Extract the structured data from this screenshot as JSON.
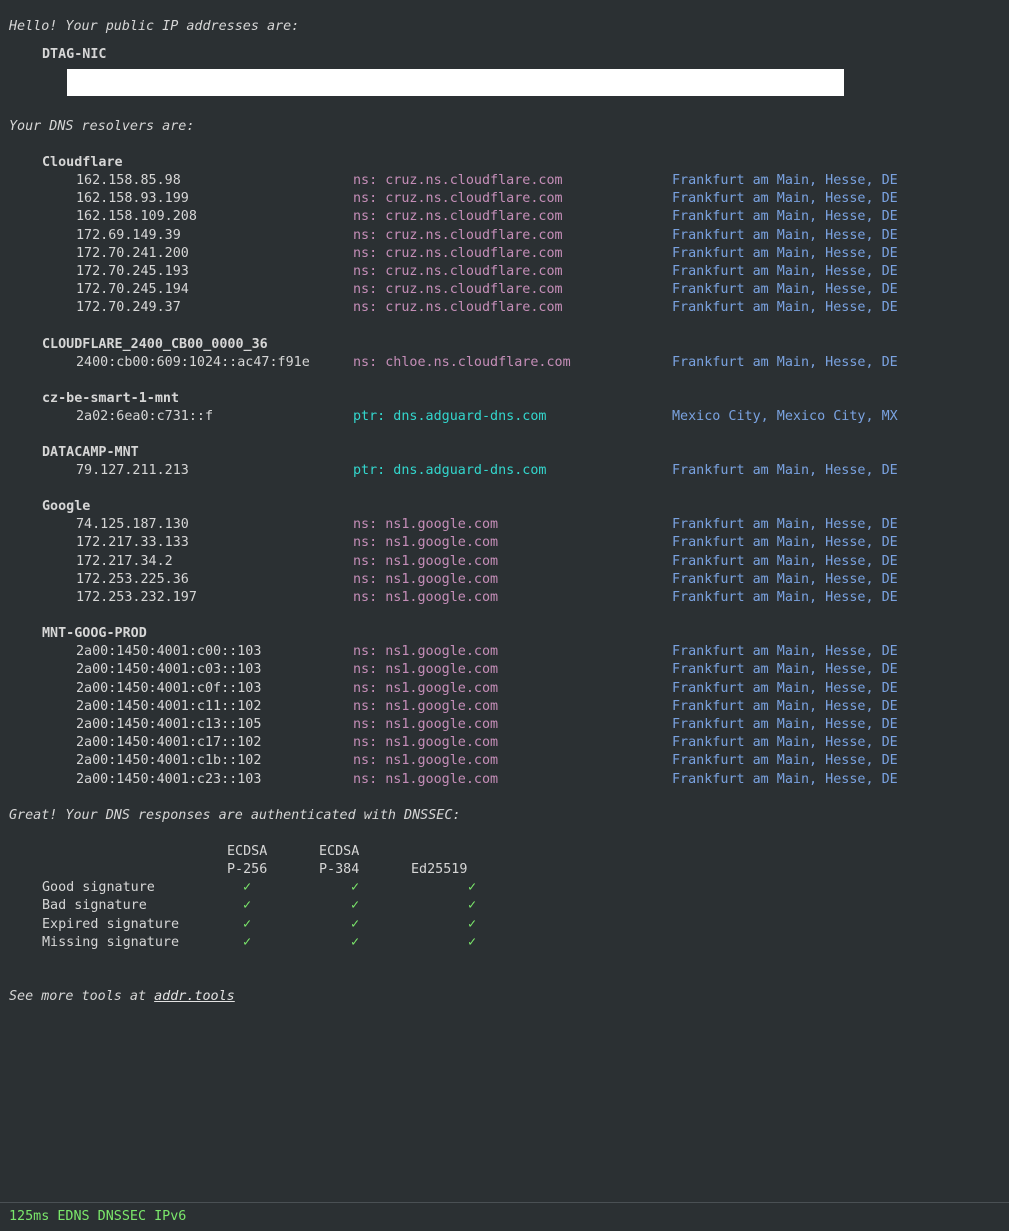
{
  "intro": "Hello! Your public IP addresses are:",
  "public_ip": {
    "org": "DTAG-NIC"
  },
  "resolvers_title": "Your DNS resolvers are:",
  "resolvers": [
    {
      "name": "Cloudflare",
      "rows": [
        {
          "ip": "162.158.85.98",
          "kind": "ns",
          "host": "ns: cruz.ns.cloudflare.com",
          "loc": "Frankfurt am Main, Hesse, DE"
        },
        {
          "ip": "162.158.93.199",
          "kind": "ns",
          "host": "ns: cruz.ns.cloudflare.com",
          "loc": "Frankfurt am Main, Hesse, DE"
        },
        {
          "ip": "162.158.109.208",
          "kind": "ns",
          "host": "ns: cruz.ns.cloudflare.com",
          "loc": "Frankfurt am Main, Hesse, DE"
        },
        {
          "ip": "172.69.149.39",
          "kind": "ns",
          "host": "ns: cruz.ns.cloudflare.com",
          "loc": "Frankfurt am Main, Hesse, DE"
        },
        {
          "ip": "172.70.241.200",
          "kind": "ns",
          "host": "ns: cruz.ns.cloudflare.com",
          "loc": "Frankfurt am Main, Hesse, DE"
        },
        {
          "ip": "172.70.245.193",
          "kind": "ns",
          "host": "ns: cruz.ns.cloudflare.com",
          "loc": "Frankfurt am Main, Hesse, DE"
        },
        {
          "ip": "172.70.245.194",
          "kind": "ns",
          "host": "ns: cruz.ns.cloudflare.com",
          "loc": "Frankfurt am Main, Hesse, DE"
        },
        {
          "ip": "172.70.249.37",
          "kind": "ns",
          "host": "ns: cruz.ns.cloudflare.com",
          "loc": "Frankfurt am Main, Hesse, DE"
        }
      ]
    },
    {
      "name": "CLOUDFLARE_2400_CB00_0000_36",
      "rows": [
        {
          "ip": "2400:cb00:609:1024::ac47:f91e",
          "kind": "ns",
          "host": "ns: chloe.ns.cloudflare.com",
          "loc": "Frankfurt am Main, Hesse, DE"
        }
      ]
    },
    {
      "name": "cz-be-smart-1-mnt",
      "rows": [
        {
          "ip": "2a02:6ea0:c731::f",
          "kind": "ptr",
          "host": "ptr: dns.adguard-dns.com",
          "loc": "Mexico City, Mexico City, MX"
        }
      ]
    },
    {
      "name": "DATACAMP-MNT",
      "rows": [
        {
          "ip": "79.127.211.213",
          "kind": "ptr",
          "host": "ptr: dns.adguard-dns.com",
          "loc": "Frankfurt am Main, Hesse, DE"
        }
      ]
    },
    {
      "name": "Google",
      "rows": [
        {
          "ip": "74.125.187.130",
          "kind": "ns",
          "host": "ns: ns1.google.com",
          "loc": "Frankfurt am Main, Hesse, DE"
        },
        {
          "ip": "172.217.33.133",
          "kind": "ns",
          "host": "ns: ns1.google.com",
          "loc": "Frankfurt am Main, Hesse, DE"
        },
        {
          "ip": "172.217.34.2",
          "kind": "ns",
          "host": "ns: ns1.google.com",
          "loc": "Frankfurt am Main, Hesse, DE"
        },
        {
          "ip": "172.253.225.36",
          "kind": "ns",
          "host": "ns: ns1.google.com",
          "loc": "Frankfurt am Main, Hesse, DE"
        },
        {
          "ip": "172.253.232.197",
          "kind": "ns",
          "host": "ns: ns1.google.com",
          "loc": "Frankfurt am Main, Hesse, DE"
        }
      ]
    },
    {
      "name": "MNT-GOOG-PROD",
      "rows": [
        {
          "ip": "2a00:1450:4001:c00::103",
          "kind": "ns",
          "host": "ns: ns1.google.com",
          "loc": "Frankfurt am Main, Hesse, DE"
        },
        {
          "ip": "2a00:1450:4001:c03::103",
          "kind": "ns",
          "host": "ns: ns1.google.com",
          "loc": "Frankfurt am Main, Hesse, DE"
        },
        {
          "ip": "2a00:1450:4001:c0f::103",
          "kind": "ns",
          "host": "ns: ns1.google.com",
          "loc": "Frankfurt am Main, Hesse, DE"
        },
        {
          "ip": "2a00:1450:4001:c11::102",
          "kind": "ns",
          "host": "ns: ns1.google.com",
          "loc": "Frankfurt am Main, Hesse, DE"
        },
        {
          "ip": "2a00:1450:4001:c13::105",
          "kind": "ns",
          "host": "ns: ns1.google.com",
          "loc": "Frankfurt am Main, Hesse, DE"
        },
        {
          "ip": "2a00:1450:4001:c17::102",
          "kind": "ns",
          "host": "ns: ns1.google.com",
          "loc": "Frankfurt am Main, Hesse, DE"
        },
        {
          "ip": "2a00:1450:4001:c1b::102",
          "kind": "ns",
          "host": "ns: ns1.google.com",
          "loc": "Frankfurt am Main, Hesse, DE"
        },
        {
          "ip": "2a00:1450:4001:c23::103",
          "kind": "ns",
          "host": "ns: ns1.google.com",
          "loc": "Frankfurt am Main, Hesse, DE"
        }
      ]
    }
  ],
  "dnssec": {
    "title": "Great! Your DNS responses are authenticated with DNSSEC:",
    "columns": [
      {
        "line1": "ECDSA",
        "line2": "P-256"
      },
      {
        "line1": "ECDSA",
        "line2": "P-384"
      },
      {
        "line1": "",
        "line2": "Ed25519"
      }
    ],
    "rows": [
      {
        "label": "Good signature",
        "marks": [
          "✓",
          "✓",
          "✓"
        ]
      },
      {
        "label": "Bad signature",
        "marks": [
          "✓",
          "✓",
          "✓"
        ]
      },
      {
        "label": "Expired signature",
        "marks": [
          "✓",
          "✓",
          "✓"
        ]
      },
      {
        "label": "Missing signature",
        "marks": [
          "✓",
          "✓",
          "✓"
        ]
      }
    ]
  },
  "more_tools": {
    "prefix": "See more tools at ",
    "link": "addr.tools"
  },
  "footer": "125ms EDNS DNSSEC IPv6",
  "colors": {
    "background": "#2b3033",
    "ns": "#c58eb8",
    "ptr": "#33d6cd",
    "location": "#7aa2e0",
    "check": "#7be86b",
    "mask": "#ffffff"
  }
}
